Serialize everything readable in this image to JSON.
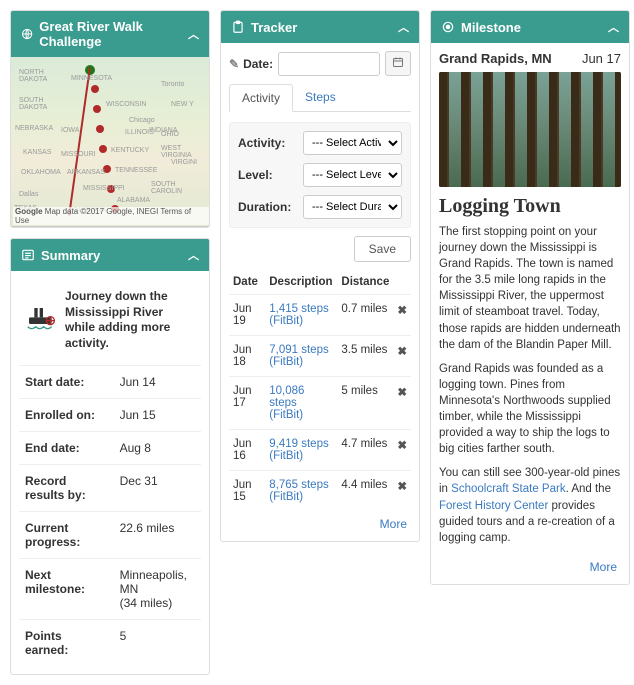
{
  "challenge": {
    "title": "Great River Walk Challenge",
    "map_attrib": "Map data ©2017 Google, INEGI  Terms of Use",
    "google": "Google"
  },
  "summary": {
    "title": "Summary",
    "message": "Journey down the Mississippi River while adding more activity.",
    "rows": [
      {
        "label": "Start date:",
        "value": "Jun 14"
      },
      {
        "label": "Enrolled on:",
        "value": "Jun 15"
      },
      {
        "label": "End date:",
        "value": "Aug 8"
      },
      {
        "label": "Record results by:",
        "value": "Dec 31"
      },
      {
        "label": "Current progress:",
        "value": "22.6 miles"
      },
      {
        "label": "Next milestone:",
        "value": "Minneapolis, MN\n(34 miles)"
      },
      {
        "label": "Points earned:",
        "value": "5"
      }
    ]
  },
  "tracker": {
    "title": "Tracker",
    "date_label": "Date:",
    "tabs": {
      "activity": "Activity",
      "steps": "Steps"
    },
    "form": {
      "activity_label": "Activity:",
      "activity_placeholder": "--- Select Activity ---",
      "level_label": "Level:",
      "level_placeholder": "--- Select Level ---",
      "duration_label": "Duration:",
      "duration_placeholder": "--- Select Duration ---",
      "save": "Save"
    },
    "table": {
      "headers": {
        "date": "Date",
        "desc": "Description",
        "dist": "Distance"
      },
      "rows": [
        {
          "date": "Jun 19",
          "desc": "1,415 steps",
          "src": "(FitBit)",
          "dist": "0.7 miles"
        },
        {
          "date": "Jun 18",
          "desc": "7,091 steps",
          "src": "(FitBit)",
          "dist": "3.5 miles"
        },
        {
          "date": "Jun 17",
          "desc": "10,086 steps",
          "src": "(FitBit)",
          "dist": "5 miles"
        },
        {
          "date": "Jun 16",
          "desc": "9,419 steps",
          "src": "(FitBit)",
          "dist": "4.7 miles"
        },
        {
          "date": "Jun 15",
          "desc": "8,765 steps",
          "src": "(FitBit)",
          "dist": "4.4 miles"
        }
      ],
      "more": "More"
    }
  },
  "milestone": {
    "title": "Milestone",
    "location": "Grand Rapids, MN",
    "date": "Jun 17",
    "heading": "Logging Town",
    "p1": "The first stopping point on your journey down the Mississippi is Grand Rapids. The town is named for the 3.5 mile long rapids in the Mississippi River, the uppermost limit of steamboat travel. Today, those rapids are hidden underneath the dam of the Blandin Paper Mill.",
    "p2a": "Grand Rapids was founded as a logging town. Pines from Minnesota's Northwoods supplied timber, while the Mississippi provided a way to ship the logs to big cities farther south.",
    "p3a": "You can still see 300-year-old pines in ",
    "p3link1": "Schoolcraft State Park",
    "p3b": ". And the ",
    "p3link2": "Forest History Center",
    "p3c": " provides guided tours and a re-creation of a logging camp.",
    "more": "More"
  }
}
